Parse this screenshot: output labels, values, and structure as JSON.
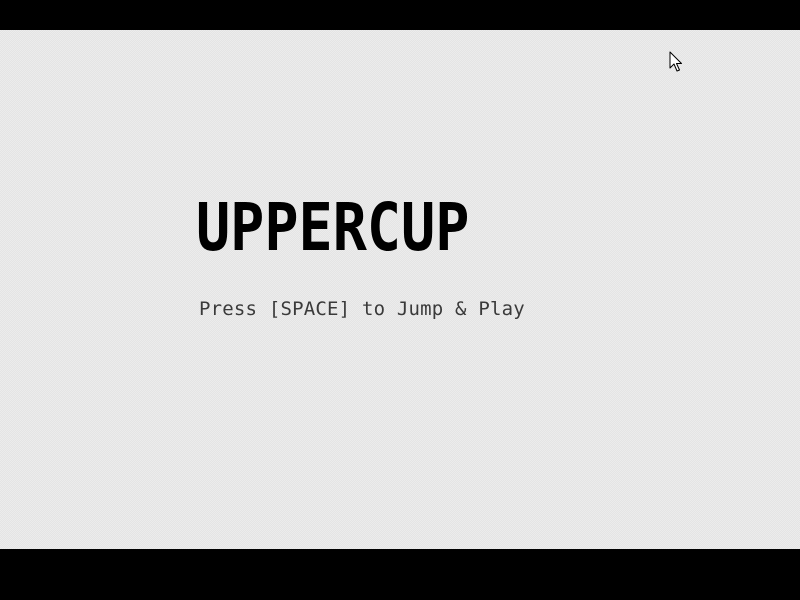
{
  "game": {
    "title": "UPPERCUP",
    "prompt": "Press [SPACE] to Jump & Play"
  },
  "pointer": {
    "icon": "mouse-pointer-icon"
  },
  "colors": {
    "background": "#ececec",
    "letterbox": "#000000",
    "title": "#000000",
    "prompt": "#3a3a3a"
  }
}
